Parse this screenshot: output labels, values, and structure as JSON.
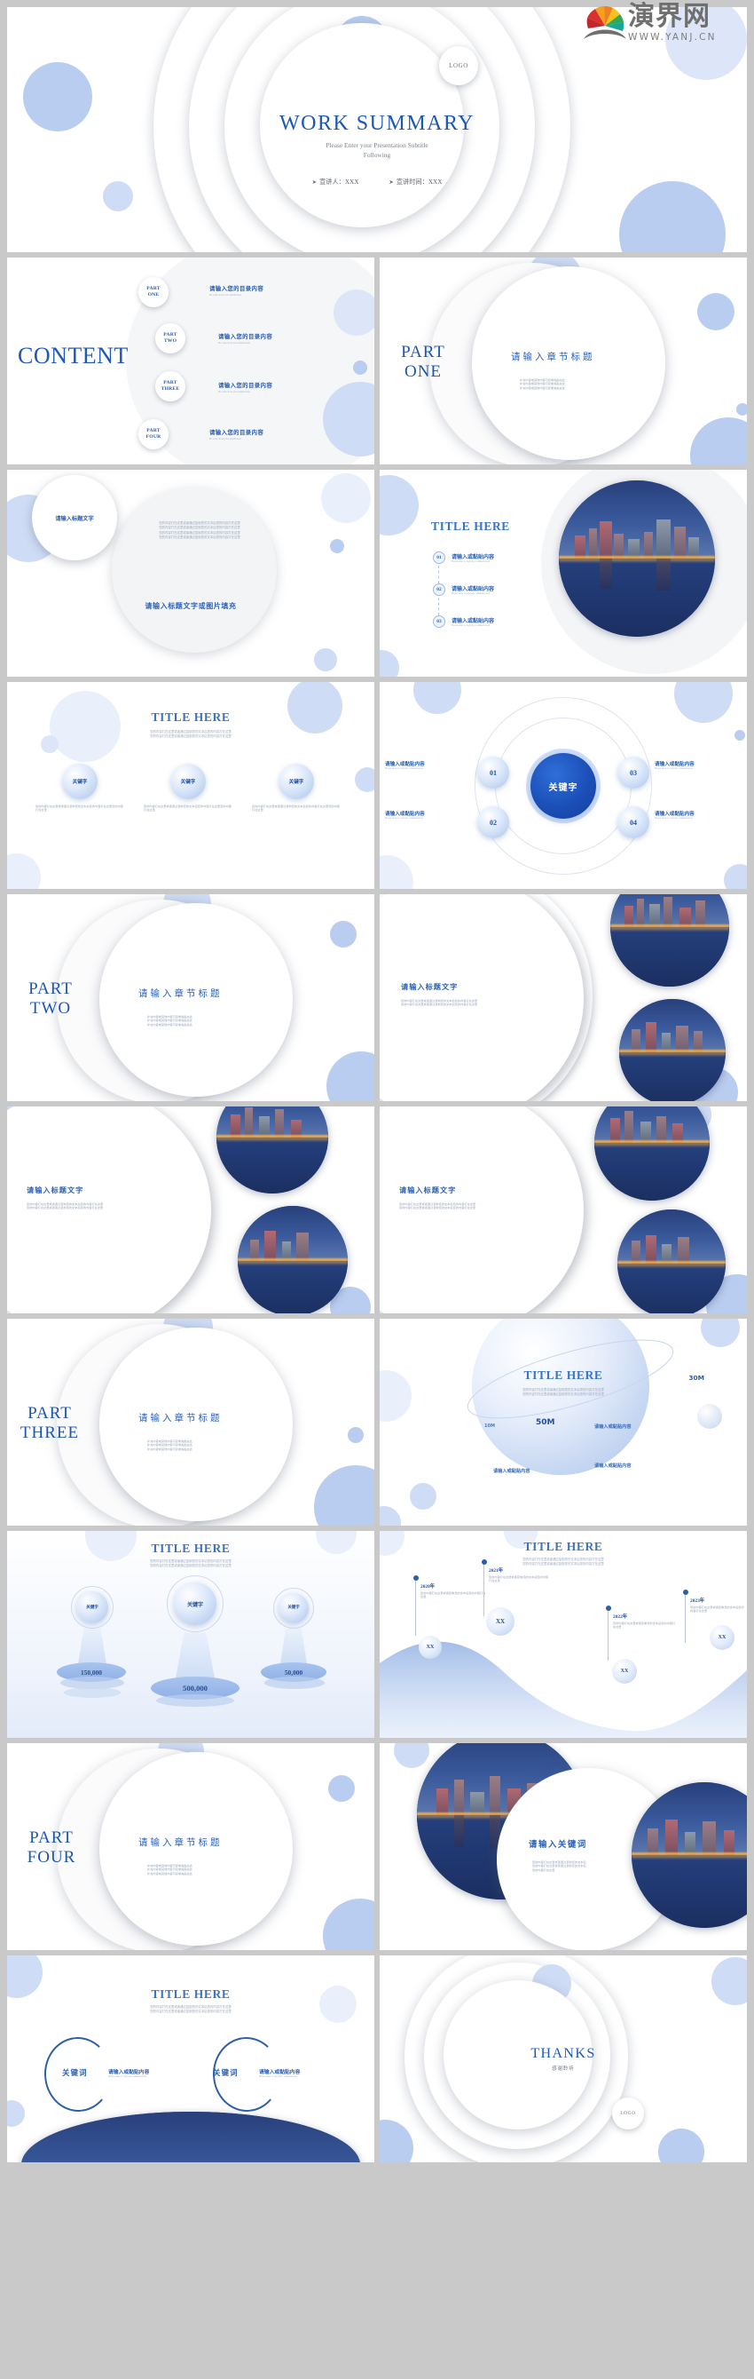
{
  "watermark": {
    "brand": "演界网",
    "url": "WWW.YANJ.CN"
  },
  "theme": {
    "primary": "#1c58b5",
    "accent": "#2a61b6",
    "bubble": "#b9cdf0",
    "pale": "#dde6f8",
    "text_grey": "#8a8f98"
  },
  "slides": [
    {
      "id": "cover",
      "logo": "LOGO",
      "title": "WORK SUMMARY",
      "subtitle_line1": "Please Enter your Presentation Subtitle",
      "subtitle_line2": "Following",
      "meta": [
        {
          "label": "宣讲人：",
          "value": "XXX"
        },
        {
          "label": "宣讲时间：",
          "value": "XXX"
        }
      ]
    },
    {
      "id": "content",
      "heading": "CONTENT",
      "items": [
        {
          "part_top": "PART",
          "part_bottom": "ONE",
          "title": "请输入您的目录内容",
          "sub": "Pls write down your subtitle here"
        },
        {
          "part_top": "PART",
          "part_bottom": "TWO",
          "title": "请输入您的目录内容",
          "sub": "Pls write down your subtitle here"
        },
        {
          "part_top": "PART",
          "part_bottom": "THREE",
          "title": "请输入您的目录内容",
          "sub": "Pls write down your subtitle here"
        },
        {
          "part_top": "PART",
          "part_bottom": "FOUR",
          "title": "请输入您的目录内容",
          "sub": "Pls write down your subtitle here"
        }
      ]
    },
    {
      "id": "part-one",
      "part_top": "PART",
      "part_bottom": "ONE",
      "section_title": "请输入章节标题",
      "body_lines": [
        "补充内容或其他内容可复制黏贴在此",
        "补充内容或其他内容可复制黏贴在此",
        "补充内容或其他内容可复制黏贴在此"
      ]
    },
    {
      "id": "text-circle",
      "bubble_title": "请输入标题文字",
      "body_lines": [
        "您的内容打在这里或者通过复制您的文本后您的内容打在这里",
        "您的内容打在这里或者通过复制您的文本后您的内容打在这里",
        "您的内容打在这里或者通过复制您的文本后您的内容打在这里",
        "您的内容打在这里或者通过复制您的文本后您的内容打在这里"
      ],
      "caption": "请输入标题文字或图片填充"
    },
    {
      "id": "title-list-photo",
      "title": "TITLE HERE",
      "items": [
        {
          "num": "01",
          "title": "请输入或黏贴内容",
          "sub": "Please enter or copy the comments here"
        },
        {
          "num": "02",
          "title": "请输入或黏贴内容",
          "sub": "Please enter or copy the comments here"
        },
        {
          "num": "03",
          "title": "请输入或黏贴内容",
          "sub": "Please enter or copy the comments here"
        }
      ]
    },
    {
      "id": "three-bubbles",
      "title": "TITLE HERE",
      "subtitle_lines": [
        "您的内容打在这里或者通过复制您的文本后您的内容打在这里",
        "您的内容打在这里或者通过复制您的文本后您的内容打在这里"
      ],
      "columns": [
        {
          "keyword": "关键字",
          "body": "您的内容打在这里或者通过复制您的文本后您的内容打在这里您的内容打在这里"
        },
        {
          "keyword": "关键字",
          "body": "您的内容打在这里或者通过复制您的文本后您的内容打在这里您的内容打在这里"
        },
        {
          "keyword": "关键字",
          "body": "您的内容打在这里或者通过复制您的文本后您的内容打在这里您的内容打在这里"
        }
      ]
    },
    {
      "id": "orbit-keyword",
      "center": "关键字",
      "nodes": [
        {
          "num": "01",
          "title": "请输入或黏贴内容",
          "sub": "Please enter or copy the comments here",
          "pos": "top-left"
        },
        {
          "num": "02",
          "title": "请输入或黏贴内容",
          "sub": "Please enter or copy the comments here",
          "pos": "bottom-left"
        },
        {
          "num": "03",
          "title": "请输入或黏贴内容",
          "sub": "Please enter or copy the comments here",
          "pos": "top-right"
        },
        {
          "num": "04",
          "title": "请输入或黏贴内容",
          "sub": "Please enter or copy the comments here",
          "pos": "bottom-right"
        }
      ]
    },
    {
      "id": "part-two",
      "part_top": "PART",
      "part_bottom": "TWO",
      "section_title": "请输入章节标题",
      "body_lines": [
        "补充内容或其他内容可复制黏贴在此",
        "补充内容或其他内容可复制黏贴在此",
        "补充内容或其他内容可复制黏贴在此"
      ]
    },
    {
      "id": "photo-right-1",
      "title": "请输入标题文字",
      "body_lines": [
        "您的内容打在这里或者通过复制您的文本后您的内容打在这里",
        "您的内容打在这里或者通过复制您的文本后您的内容打在这里"
      ]
    },
    {
      "id": "photo-right-2",
      "title": "请输入标题文字",
      "body_lines": [
        "您的内容打在这里或者通过复制您的文本后您的内容打在这里",
        "您的内容打在这里或者通过复制您的文本后您的内容打在这里"
      ]
    },
    {
      "id": "photo-right-3",
      "title": "请输入标题文字",
      "body_lines": [
        "您的内容打在这里或者通过复制您的文本后您的内容打在这里",
        "您的内容打在这里或者通过复制您的文本后您的内容打在这里"
      ]
    },
    {
      "id": "part-three",
      "part_top": "PART",
      "part_bottom": "THREE",
      "section_title": "请输入章节标题",
      "body_lines": [
        "补充内容或其他内容可复制黏贴在此",
        "补充内容或其他内容可复制黏贴在此",
        "补充内容或其他内容可复制黏贴在此"
      ]
    },
    {
      "id": "planet-stats",
      "title": "TITLE HERE",
      "subtitle_lines": [
        "您的内容打在这里或者通过复制您的文本后您的内容打在这里",
        "您的内容打在这里或者通过复制您的文本后您的内容打在这里"
      ],
      "stats": [
        {
          "value": "30M",
          "label": ""
        },
        {
          "value": "50M",
          "label": "请输入或黏贴内容"
        },
        {
          "value": "10M",
          "label": ""
        }
      ],
      "captions": [
        "请输入或黏贴内容",
        "请输入或黏贴内容"
      ]
    },
    {
      "id": "podium",
      "title": "TITLE HERE",
      "subtitle_lines": [
        "您的内容打在这里或者通过复制您的文本后您的内容打在这里",
        "您的内容打在这里或者通过复制您的文本后您的内容打在这里"
      ],
      "chart_data": {
        "type": "bar",
        "title": "TITLE HERE",
        "categories": [
          "关键字",
          "关键字",
          "关键字"
        ],
        "values": [
          150000,
          500000,
          50000
        ],
        "value_labels": [
          "150,000",
          "500,000",
          "50,000"
        ],
        "xlabel": "",
        "ylabel": "",
        "ylim": [
          0,
          500000
        ],
        "legend": "none",
        "grid": false
      }
    },
    {
      "id": "timeline",
      "title": "TITLE HERE",
      "subtitle_lines": [
        "您的内容打在这里或者通过复制您的文本后您的内容打在这里",
        "您的内容打在这里或者通过复制您的文本后您的内容打在这里"
      ],
      "chart_data": {
        "type": "area",
        "title": "TITLE HERE",
        "x": [
          "2020年",
          "2021年",
          "2022年",
          "2023年"
        ],
        "values": [
          28,
          62,
          18,
          55
        ],
        "point_labels": [
          "XX",
          "XX",
          "XX",
          "XX"
        ],
        "annotations": [
          {
            "x": "2020年",
            "text": "您的内容打在这里或者复制您的文本后您的内容打在这里"
          },
          {
            "x": "2021年",
            "text": "您的内容打在这里或者复制您的文本后您的内容打在这里"
          },
          {
            "x": "2022年",
            "text": "您的内容打在这里或者复制您的文本后您的内容打在这里"
          },
          {
            "x": "2023年",
            "text": "您的内容打在这里或者复制您的文本后您的内容打在这里"
          }
        ],
        "xlabel": "",
        "ylabel": "",
        "grid": false,
        "legend": "none"
      }
    },
    {
      "id": "part-four",
      "part_top": "PART",
      "part_bottom": "FOUR",
      "section_title": "请输入章节标题",
      "body_lines": [
        "补充内容或其他内容可复制黏贴在此",
        "补充内容或其他内容可复制黏贴在此",
        "补充内容或其他内容可复制黏贴在此"
      ]
    },
    {
      "id": "keyword-photo",
      "title": "请输入关键词",
      "body_lines": [
        "您的内容打在这里或者通过复制您的文本后",
        "您的内容打在这里或者通过复制您的文本后",
        "您的内容打在这里"
      ]
    },
    {
      "id": "two-arcs",
      "title": "TITLE HERE",
      "subtitle_lines": [
        "您的内容打在这里或者通过复制您的文本后您的内容打在这里",
        "您的内容打在这里或者通过复制您的文本后您的内容打在这里"
      ],
      "items": [
        {
          "keyword": "关键词",
          "title": "请输入或黏贴内容",
          "sub": "Please enter or copy the comments here"
        },
        {
          "keyword": "关键词",
          "title": "请输入或黏贴内容",
          "sub": "Please enter or copy the comments here"
        }
      ]
    },
    {
      "id": "thanks",
      "title": "THANKS",
      "subtitle": "感谢聆听",
      "logo": "LOGO"
    }
  ]
}
